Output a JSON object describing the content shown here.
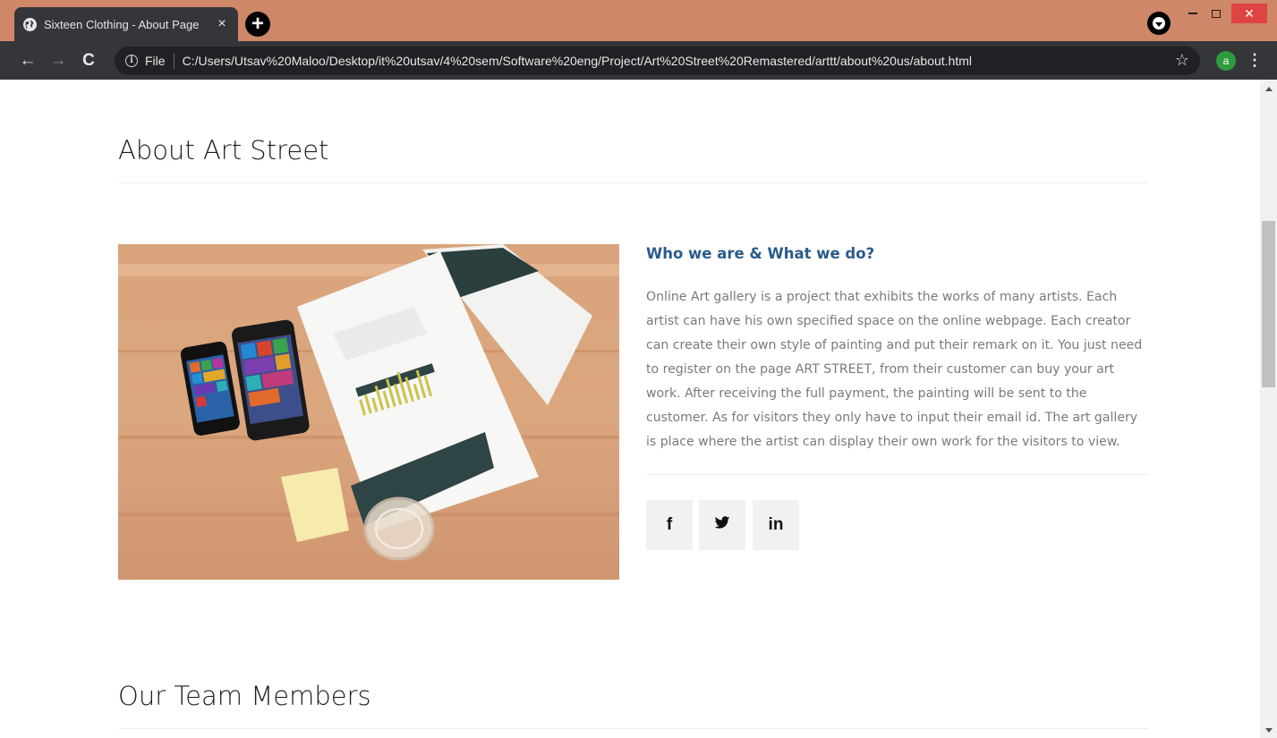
{
  "browser": {
    "tab_title": "Sixteen Clothing - About Page",
    "tab_close": "×",
    "new_tab": "+",
    "file_label": "File",
    "url": "C:/Users/Utsav%20Maloo/Desktop/it%20utsav/4%20sem/Software%20eng/Project/Art%20Street%20Remastered/arttt/about%20us/about.html",
    "profile_initial": "a",
    "window_close": "✕",
    "back": "←",
    "forward": "→",
    "reload": "C",
    "info": "i",
    "star": "☆",
    "menu": "⋮"
  },
  "about": {
    "heading": "About Art Street",
    "subheading": "Who we are & What we do?",
    "body": "Online Art gallery is a project that exhibits the works of many artists. Each artist can have his own specified space on the online webpage. Each creator can create their own style of painting and put their remark on it. You just need to register on the page ART STREET, from their customer can buy your art work. After receiving the full payment, the painting will be sent to the customer. As for visitors they only have to input their email id. The art gallery is place where the artist can display their own work for the visitors to view.",
    "image_alt": "",
    "social": {
      "facebook": "f",
      "linkedin": "in"
    }
  },
  "team": {
    "heading": "Our Team Members"
  },
  "colors": {
    "titlebar": "#ce8868",
    "toolbar": "#35363a",
    "subheading": "#2a5b8a",
    "body_text": "#7a7a7a",
    "social_bg": "#f1f1f1"
  },
  "icons": {
    "tab_favicon": "globe-icon",
    "twitter": "twitter-icon",
    "facebook": "facebook-icon",
    "linkedin": "linkedin-icon"
  }
}
